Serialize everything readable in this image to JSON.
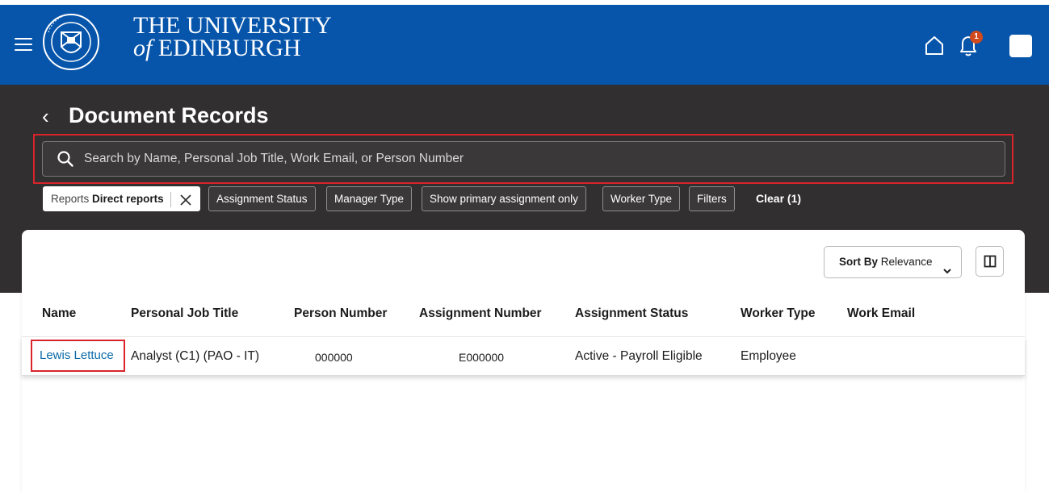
{
  "header": {
    "brand_line1": "THE UNIVERSITY",
    "brand_of": "of",
    "brand_line2": "EDINBURGH",
    "notification_count": "1",
    "colors": {
      "header_bg": "#0755ab",
      "dark_band": "#312f2f",
      "highlight": "#d8242a",
      "link": "#0b6aa8"
    },
    "icons": [
      "hamburger-menu-icon",
      "university-crest-icon",
      "home-icon",
      "bell-icon",
      "user-avatar-icon"
    ]
  },
  "page": {
    "back_label": "‹",
    "title": "Document Records"
  },
  "search": {
    "placeholder": "Search by Name, Personal Job Title, Work Email, or Person Number",
    "value": ""
  },
  "filters": {
    "reports_label": "Reports",
    "reports_value": "Direct reports",
    "chips": [
      "Assignment Status",
      "Manager Type",
      "Show primary assignment only",
      "Worker Type",
      "Filters"
    ],
    "clear_label": "Clear (1)"
  },
  "sort": {
    "label": "Sort By",
    "value": "Relevance"
  },
  "table": {
    "columns": [
      "Name",
      "Personal Job Title",
      "Person Number",
      "Assignment Number",
      "Assignment Status",
      "Worker Type",
      "Work Email"
    ],
    "rows": [
      {
        "name": "Lewis Lettuce",
        "job_title": "Analyst (C1) (PAO - IT)",
        "person_number": "000000",
        "assignment_number": "E000000",
        "assignment_status": "Active - Payroll Eligible",
        "worker_type": "Employee",
        "work_email": ""
      }
    ]
  }
}
